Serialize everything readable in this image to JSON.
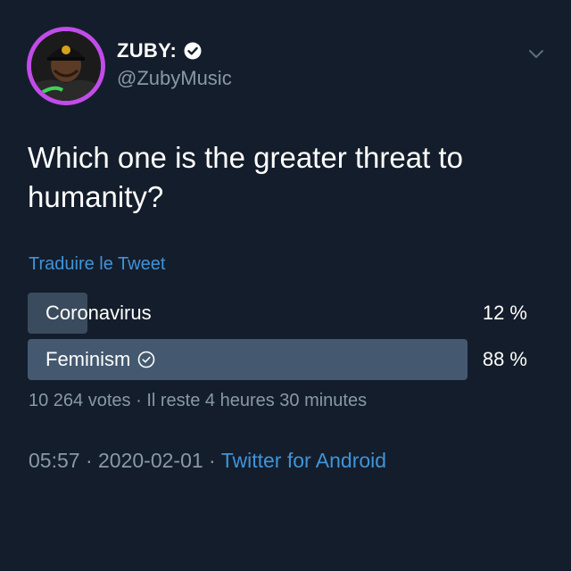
{
  "author": {
    "display_name": "ZUBY:",
    "handle": "@ZubyMusic",
    "verified": true,
    "avatar_ring_color": "#c14ce8"
  },
  "tweet": {
    "text": "Which one is the greater threat to humanity?",
    "translate_label": "Traduire le Tweet"
  },
  "poll": {
    "options": [
      {
        "label": "Coronavirus",
        "percent_text": "12 %",
        "percent": 12,
        "selected": false
      },
      {
        "label": "Feminism",
        "percent_text": "88 %",
        "percent": 88,
        "selected": true
      }
    ],
    "summary": {
      "votes": "10 264 votes",
      "separator": " · ",
      "time_left": "Il reste 4 heures 30 minutes"
    }
  },
  "meta": {
    "time": "05:57",
    "separator": " · ",
    "date": "2020-02-01",
    "source": "Twitter for Android"
  },
  "colors": {
    "background": "#141d2b",
    "link": "#3f94d9",
    "secondary_text": "#8899a6",
    "poll_bar": "#3a4b5d"
  },
  "icons": {
    "verified": "verified-badge-icon",
    "menu": "chevron-down-icon",
    "selected_choice": "check-circle-icon"
  }
}
